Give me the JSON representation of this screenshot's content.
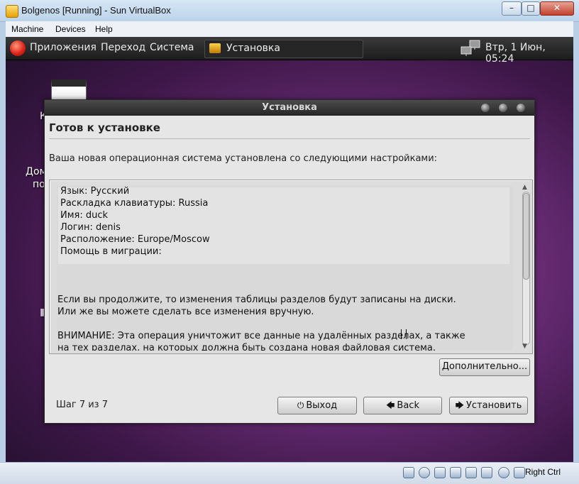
{
  "host": {
    "title": "Bolgenos [Running] - Sun VirtualBox",
    "menu": [
      "Machine",
      "Devices",
      "Help"
    ],
    "window_buttons": {
      "minimize": "–",
      "maximize": "□",
      "close": "✕"
    },
    "status": {
      "host_key": "Right Ctrl"
    }
  },
  "guest": {
    "panel": {
      "menus": [
        "Приложения",
        "Переход",
        "Система"
      ],
      "task": "Установка",
      "clock": "Втр,  1 Июн, 05:24"
    },
    "desktop": {
      "label_fragment_1": "К",
      "label_fragment_2": "Дом",
      "label_fragment_3": "по"
    },
    "installer": {
      "title": "Установка",
      "heading": "Готов к установке",
      "intro": "Ваша новая операционная система установлена со следующими настройками:",
      "summary": [
        "Язык: Русский",
        "Раскладка клавиатуры: Russia",
        "Имя: duck",
        "Логин: denis",
        "Расположение: Europe/Moscow",
        "Помощь в миграции:"
      ],
      "notice_1": "Если вы продолжите, то изменения таблицы разделов будут записаны на диски.",
      "notice_2": "Или же вы можете сделать все изменения вручную.",
      "warning_1": "ВНИМАНИЕ: Эта операция уничтожит все данные на удалённых разделах, а также",
      "warning_2": "на тех разделах, на которых должна быть создана новая файловая система.",
      "advanced_label": "Дополнительно...",
      "step_label": "Шаг 7 из 7",
      "quit_label": "Выход",
      "back_label": "Back",
      "install_label": "Установить"
    }
  }
}
